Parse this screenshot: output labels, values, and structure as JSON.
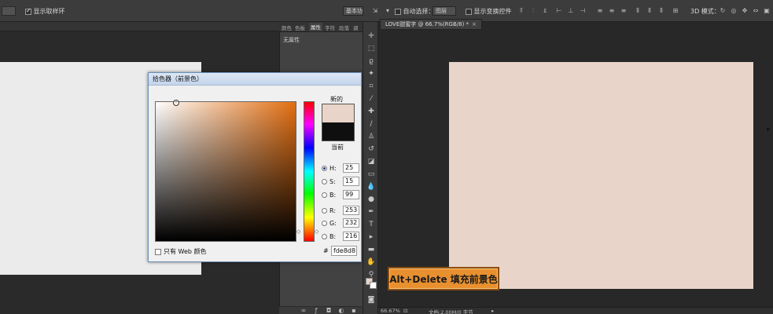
{
  "options_bar_left": {
    "show_ring_label": "显示取样环",
    "preset_label": "基本功"
  },
  "options_bar_right": {
    "move_icon": "move-arrow-icon",
    "auto_select_label": "自动选择：",
    "auto_select_value": "图层",
    "show_transform_label": "显示变换控件",
    "mode_3d_label": "3D 模式："
  },
  "panel": {
    "tabs": [
      "颜色",
      "色板",
      "属性",
      "字符",
      "段落",
      "调"
    ],
    "active_tab": "属性",
    "content_label": "无属性"
  },
  "document": {
    "tab_title": "LOVE甜蜜字 @ 66.7%(RGB/8) *",
    "close_glyph": "×",
    "zoom": "66.67%",
    "doc_info": "文档:2.00M/0 字节",
    "canvas_color": "#e8d4c8"
  },
  "callout": {
    "text": "Alt+Delete 填充前景色"
  },
  "color_picker": {
    "title": "拾色器（前景色）",
    "label_new": "新的",
    "label_current": "当前",
    "new_color": "#e8d4c8",
    "current_color": "#0f0f0f",
    "fields": [
      {
        "label": "H:",
        "value": "25",
        "selected": true
      },
      {
        "label": "S:",
        "value": "15",
        "selected": false
      },
      {
        "label": "B:",
        "value": "99",
        "selected": false
      },
      {
        "label": "R:",
        "value": "253",
        "selected": false
      },
      {
        "label": "G:",
        "value": "232",
        "selected": false
      },
      {
        "label": "B:",
        "value": "216",
        "selected": false
      }
    ],
    "web_only_label": "只有 Web 颜色",
    "hash_label": "#",
    "hex_value": "fde8d8"
  }
}
